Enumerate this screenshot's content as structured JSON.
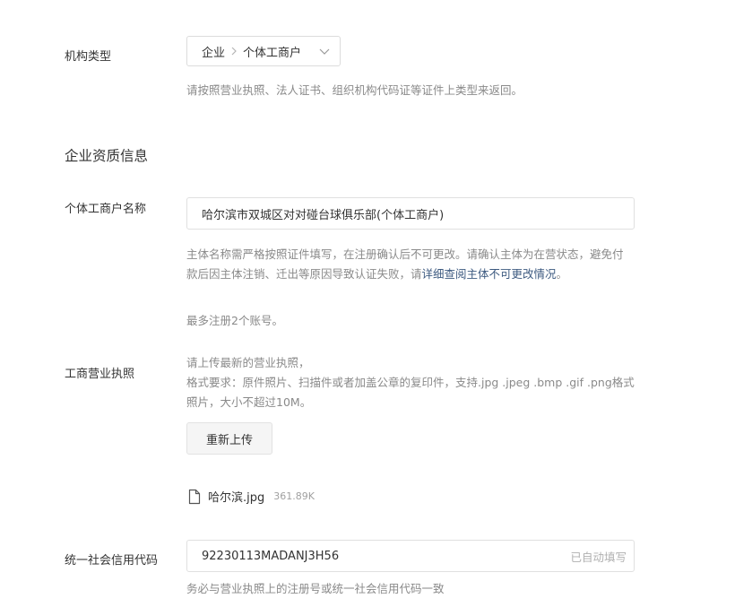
{
  "org_type": {
    "label": "机构类型",
    "level1": "企业",
    "level2": "个体工商户",
    "hint": "请按照营业执照、法人证书、组织机构代码证等证件上类型来返回。"
  },
  "qualification": {
    "section_title": "企业资质信息",
    "name_label": "个体工商户名称",
    "name_value": "哈尔滨市双城区对对碰台球俱乐部(个体工商户)",
    "name_hint_prefix": "主体名称需严格按照证件填写，在注册确认后不可更改。请确认主体为在营状态，避免付款后因主体注销、迁出等原因导致认证失败，请",
    "name_hint_link": "详细查阅主体不可更改情况",
    "name_hint_suffix": "。",
    "account_limit": "最多注册2个账号。"
  },
  "license": {
    "label": "工商营业执照",
    "desc_line1": "请上传最新的营业执照，",
    "desc_line2": "格式要求：原件照片、扫描件或者加盖公章的复印件，支持.jpg .jpeg .bmp .gif .png格式照片，大小不超过10M。",
    "reupload_label": "重新上传",
    "file_name": "哈尔滨.jpg",
    "file_size": "361.89K",
    "file_icon": "document-icon"
  },
  "credit_code": {
    "label": "统一社会信用代码",
    "value": "92230113MADANJ3H56",
    "auto_fill": "已自动填写",
    "hint": "务必与营业执照上的注册号或统一社会信用代码一致"
  }
}
